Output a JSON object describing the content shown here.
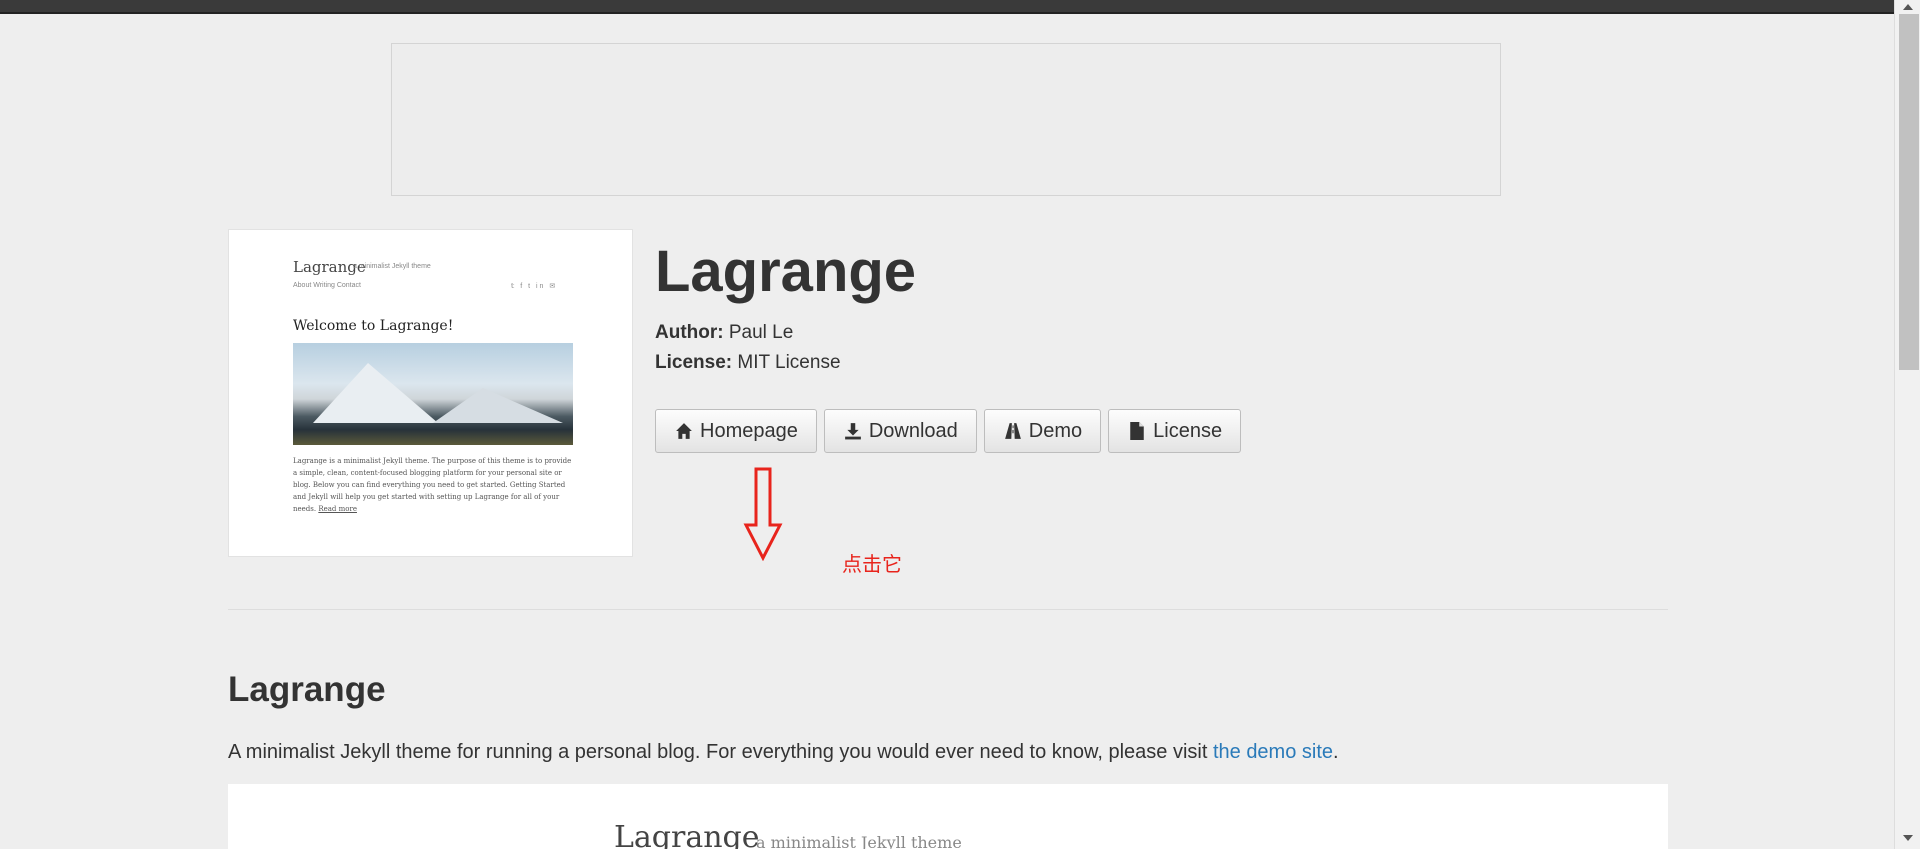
{
  "theme": {
    "name": "Lagrange",
    "author_label": "Author:",
    "author": "Paul Le",
    "license_label": "License:",
    "license": "MIT License"
  },
  "buttons": {
    "homepage": "Homepage",
    "download": "Download",
    "demo": "Demo",
    "license": "License"
  },
  "annotation": {
    "text": "点击它",
    "color": "#e8241c"
  },
  "thumbnail": {
    "title": "Lagrange",
    "tagline": "a minimalist Jekyll theme",
    "nav": "About  Writing  Contact",
    "social_icons": [
      "twitter-icon",
      "facebook-icon",
      "tumblr-icon",
      "linkedin-icon",
      "email-icon"
    ],
    "welcome": "Welcome to Lagrange!",
    "excerpt": "Lagrange is a minimalist Jekyll theme. The purpose of this theme is to provide a simple, clean, content-focused blogging platform for your personal site or blog. Below you can find everything you need to get started. Getting Started and Jekyll will help you get started with setting up Lagrange for all of your needs.",
    "read_more": "Read more"
  },
  "section": {
    "heading": "Lagrange",
    "description_prefix": "A minimalist Jekyll theme for running a personal blog. For everything you would ever need to know, please visit ",
    "description_link": "the demo site",
    "description_suffix": "."
  },
  "preview": {
    "title": "Lagrange",
    "tagline": "a minimalist Jekyll theme"
  },
  "colors": {
    "page_bg": "#eeeeee",
    "link": "#2a7ab9",
    "annotation_red": "#e8241c"
  }
}
